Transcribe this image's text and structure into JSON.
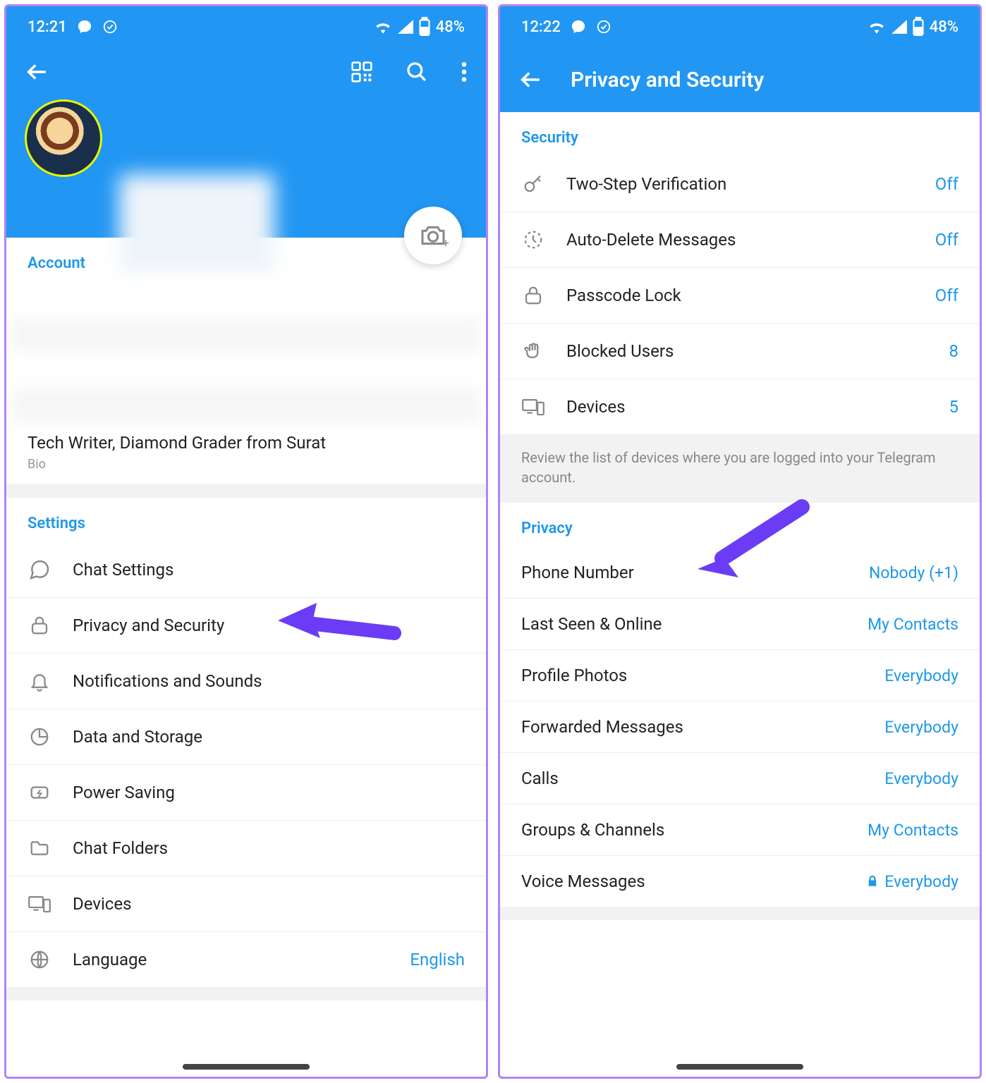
{
  "colors": {
    "accent": "#1e98e8",
    "header": "#2196f3",
    "arrow": "#6a3cf5"
  },
  "left": {
    "status": {
      "time": "12:21",
      "battery": "48%"
    },
    "account_section": "Account",
    "bio": {
      "text": "Tech Writer, Diamond Grader from Surat",
      "label": "Bio"
    },
    "settings_section": "Settings",
    "settings": [
      {
        "icon": "chat",
        "label": "Chat Settings"
      },
      {
        "icon": "lock",
        "label": "Privacy and Security"
      },
      {
        "icon": "bell",
        "label": "Notifications and Sounds"
      },
      {
        "icon": "pie",
        "label": "Data and Storage"
      },
      {
        "icon": "bolt",
        "label": "Power Saving"
      },
      {
        "icon": "folder",
        "label": "Chat Folders"
      },
      {
        "icon": "devices",
        "label": "Devices"
      },
      {
        "icon": "globe",
        "label": "Language",
        "value": "English"
      }
    ]
  },
  "right": {
    "status": {
      "time": "12:22",
      "battery": "48%"
    },
    "title": "Privacy and Security",
    "security_section": "Security",
    "security": [
      {
        "icon": "key",
        "label": "Two-Step Verification",
        "value": "Off"
      },
      {
        "icon": "timer",
        "label": "Auto-Delete Messages",
        "value": "Off"
      },
      {
        "icon": "lock",
        "label": "Passcode Lock",
        "value": "Off"
      },
      {
        "icon": "hand",
        "label": "Blocked Users",
        "value": "8"
      },
      {
        "icon": "devices",
        "label": "Devices",
        "value": "5"
      }
    ],
    "security_note": "Review the list of devices where you are logged into your Telegram account.",
    "privacy_section": "Privacy",
    "privacy": [
      {
        "label": "Phone Number",
        "value": "Nobody (+1)"
      },
      {
        "label": "Last Seen & Online",
        "value": "My Contacts"
      },
      {
        "label": "Profile Photos",
        "value": "Everybody"
      },
      {
        "label": "Forwarded Messages",
        "value": "Everybody"
      },
      {
        "label": "Calls",
        "value": "Everybody"
      },
      {
        "label": "Groups & Channels",
        "value": "My Contacts"
      },
      {
        "label": "Voice Messages",
        "value": "Everybody",
        "locked": true
      }
    ]
  }
}
